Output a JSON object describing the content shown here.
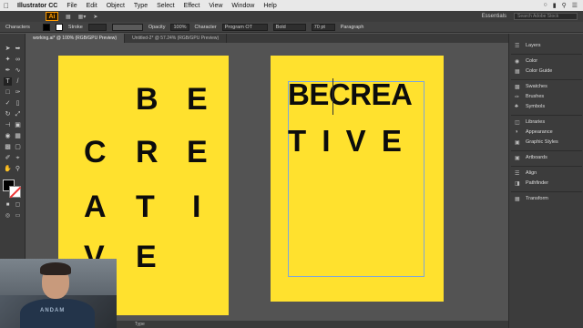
{
  "menubar": {
    "app_name": "Illustrator CC",
    "items": [
      "File",
      "Edit",
      "Object",
      "Type",
      "Select",
      "Effect",
      "View",
      "Window",
      "Help"
    ]
  },
  "appbar": {
    "logo": "Ai",
    "workspace": "Essentials",
    "search_placeholder": "Search Adobe Stock"
  },
  "controlbar": {
    "panel_label": "Characters",
    "stroke_label": "Stroke",
    "opacity_label": "Opacity",
    "opacity_value": "100%",
    "character_label": "Character",
    "font_family": "Program OT",
    "font_style": "Bold",
    "font_size": "70 pt",
    "paragraph_label": "Paragraph"
  },
  "tabs": [
    {
      "label": "working.ai* @ 100% (RGB/GPU Preview)"
    },
    {
      "label": "Untitled-2* @ 57.24% (RGB/GPU Preview)"
    }
  ],
  "artboard1": {
    "letters": [
      "B",
      "E",
      "C",
      "R",
      "E",
      "A",
      "T",
      "I",
      "V",
      "E"
    ]
  },
  "artboard2": {
    "line1": "BECREA",
    "line2": "T I V E"
  },
  "right_panels": {
    "group1": [
      "Layers"
    ],
    "group2": [
      "Color",
      "Color Guide"
    ],
    "group3": [
      "Swatches",
      "Brushes",
      "Symbols"
    ],
    "group4": [
      "Libraries",
      "Appearance",
      "Graphic Styles"
    ],
    "group5": [
      "Artboards"
    ],
    "group6": [
      "Align",
      "Pathfinder"
    ],
    "group7": [
      "Transform"
    ]
  },
  "statusbar": {
    "tool": "Type"
  },
  "webcam": {
    "shirt_text": "ANDAM"
  },
  "colors": {
    "artboard_yellow": "#ffe12e",
    "text_black": "#0c0c0c",
    "workspace_gray": "#535353"
  }
}
